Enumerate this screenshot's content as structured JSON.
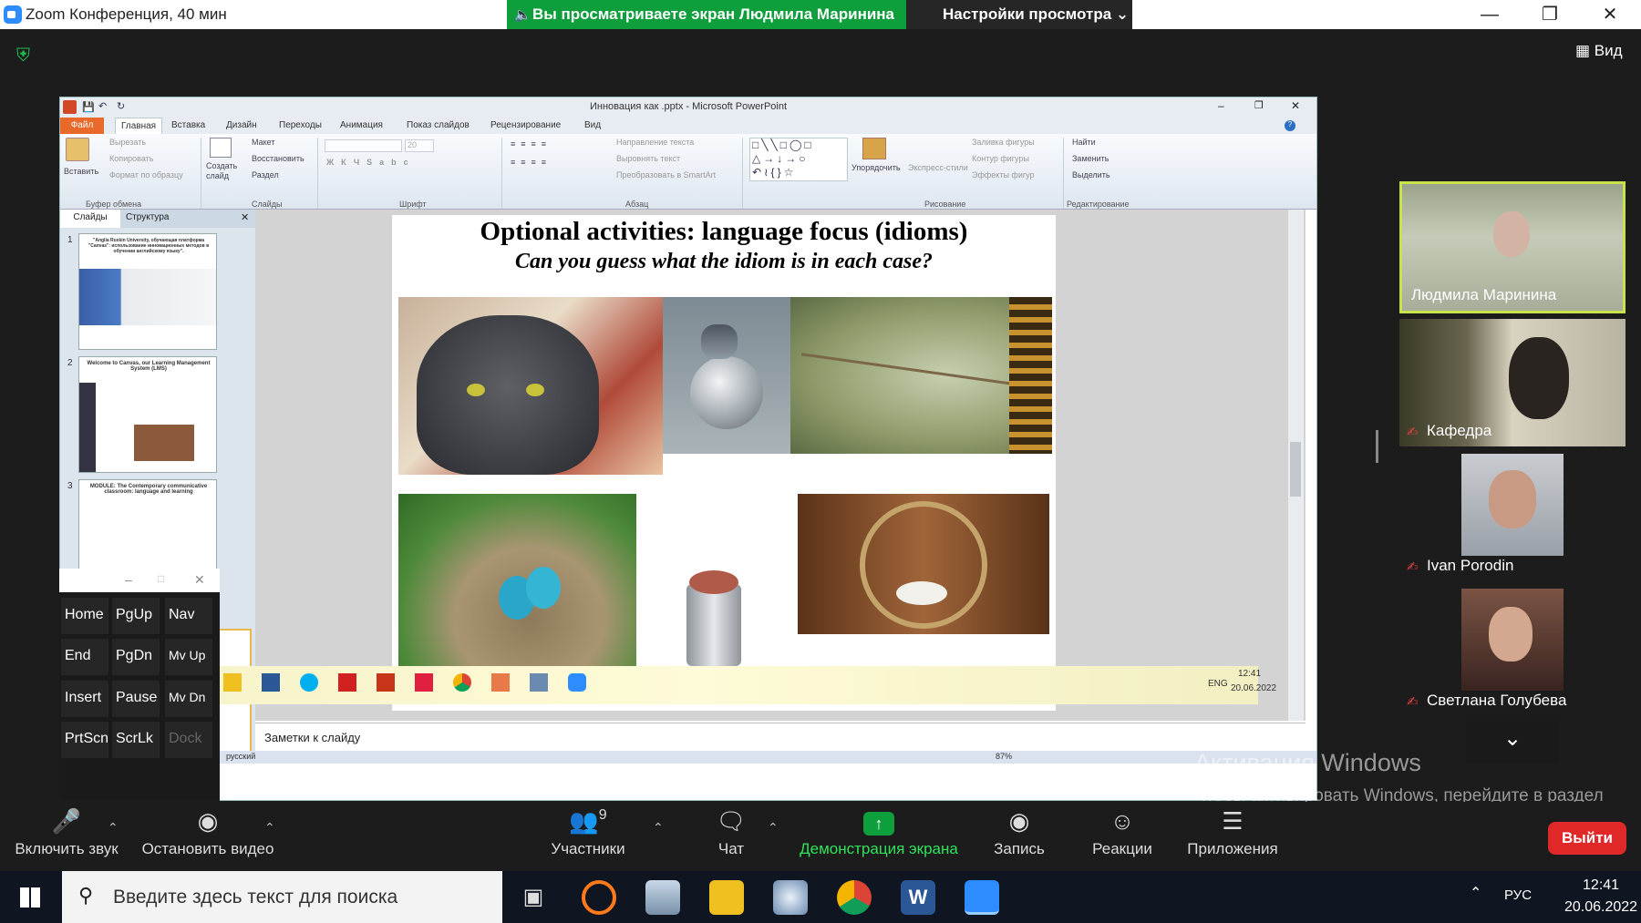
{
  "zoom": {
    "window_title": "Zoom Конференция, 40 мин",
    "viewing_banner": "Вы просматриваете экран Людмила Маринина",
    "view_settings": "Настройки просмотра",
    "view_button": "Вид"
  },
  "ppt": {
    "title": "Инновация как .pptx - Microsoft PowerPoint",
    "tabs": [
      "Файл",
      "Главная",
      "Вставка",
      "Дизайн",
      "Переходы",
      "Анимация",
      "Показ слайдов",
      "Рецензирование",
      "Вид"
    ],
    "ribbon": {
      "paste": "Вставить",
      "cut": "Вырезать",
      "copy": "Копировать",
      "format_painter": "Формат по образцу",
      "new_slide": "Создать слайд",
      "layout": "Макет",
      "reset": "Восстановить",
      "section": "Раздел",
      "font_size": "20",
      "text_direction": "Направление текста",
      "align_text": "Выровнять текст",
      "smartart": "Преобразовать в SmartArt",
      "arrange": "Упорядочить",
      "quick_styles": "Экспресс-стили",
      "shape_fill": "Заливка фигуры",
      "shape_outline": "Контур фигуры",
      "shape_effects": "Эффекты фигур",
      "find": "Найти",
      "replace": "Заменить",
      "select": "Выделить",
      "groups": [
        "Буфер обмена",
        "Слайды",
        "Шрифт",
        "Абзац",
        "Рисование",
        "Редактирование"
      ]
    },
    "pane_tabs": [
      "Слайды",
      "Структура"
    ],
    "thumbnails": [
      {
        "num": "1",
        "title": "\"Anglia Ruskin University, обучающая платформа \"Canvas\": использование инновационных методов в обучении английскому языку\"."
      },
      {
        "num": "2",
        "title": "Welcome to Canvas, our Learning Management System (LMS)"
      },
      {
        "num": "3",
        "title": "MODULE: The Contemporary communicative classroom: language and learning"
      }
    ],
    "slide_title": "Optional activities: language focus (idioms)",
    "slide_subtitle": "Can you guess what the idiom is in each case?",
    "notes_placeholder": "Заметки к слайду",
    "status_lang": "русский",
    "zoom_level": "87%",
    "tray_lang": "ENG",
    "tray_time": "12:41",
    "tray_date": "20.06.2022"
  },
  "osk": {
    "keys": [
      [
        "Home",
        "PgUp",
        "Nav"
      ],
      [
        "End",
        "PgDn",
        "Mv Up"
      ],
      [
        "Insert",
        "Pause",
        "Mv Dn"
      ],
      [
        "PrtScn",
        "ScrLk",
        "Dock"
      ]
    ]
  },
  "participants": [
    {
      "name": "Людмила Маринина",
      "muted": false,
      "active": true
    },
    {
      "name": "Кафедра",
      "muted": true,
      "active": false
    },
    {
      "name": "Ivan Porodin",
      "muted": true,
      "active": false
    },
    {
      "name": "Светлана Голубева",
      "muted": true,
      "active": false
    }
  ],
  "watermark": {
    "line1": "Активация Windows",
    "line2": "Чтобы активировать Windows, перейдите в раздел \"Параметры\"."
  },
  "toolbar": {
    "unmute": "Включить звук",
    "stop_video": "Остановить видео",
    "participants": "Участники",
    "participants_count": "9",
    "chat": "Чат",
    "share": "Демонстрация экрана",
    "record": "Запись",
    "reactions": "Реакции",
    "apps": "Приложения",
    "leave": "Выйти"
  },
  "taskbar": {
    "search_placeholder": "Введите здесь текст для поиска",
    "lang": "РУС",
    "time": "12:41",
    "date": "20.06.2022"
  },
  "colors": {
    "zoom_green": "#0e9f3c",
    "zoom_blue": "#2d8cff",
    "leave_red": "#e02828",
    "active_speaker": "#c8e34a",
    "ppt_file_tab": "#e8692a"
  }
}
